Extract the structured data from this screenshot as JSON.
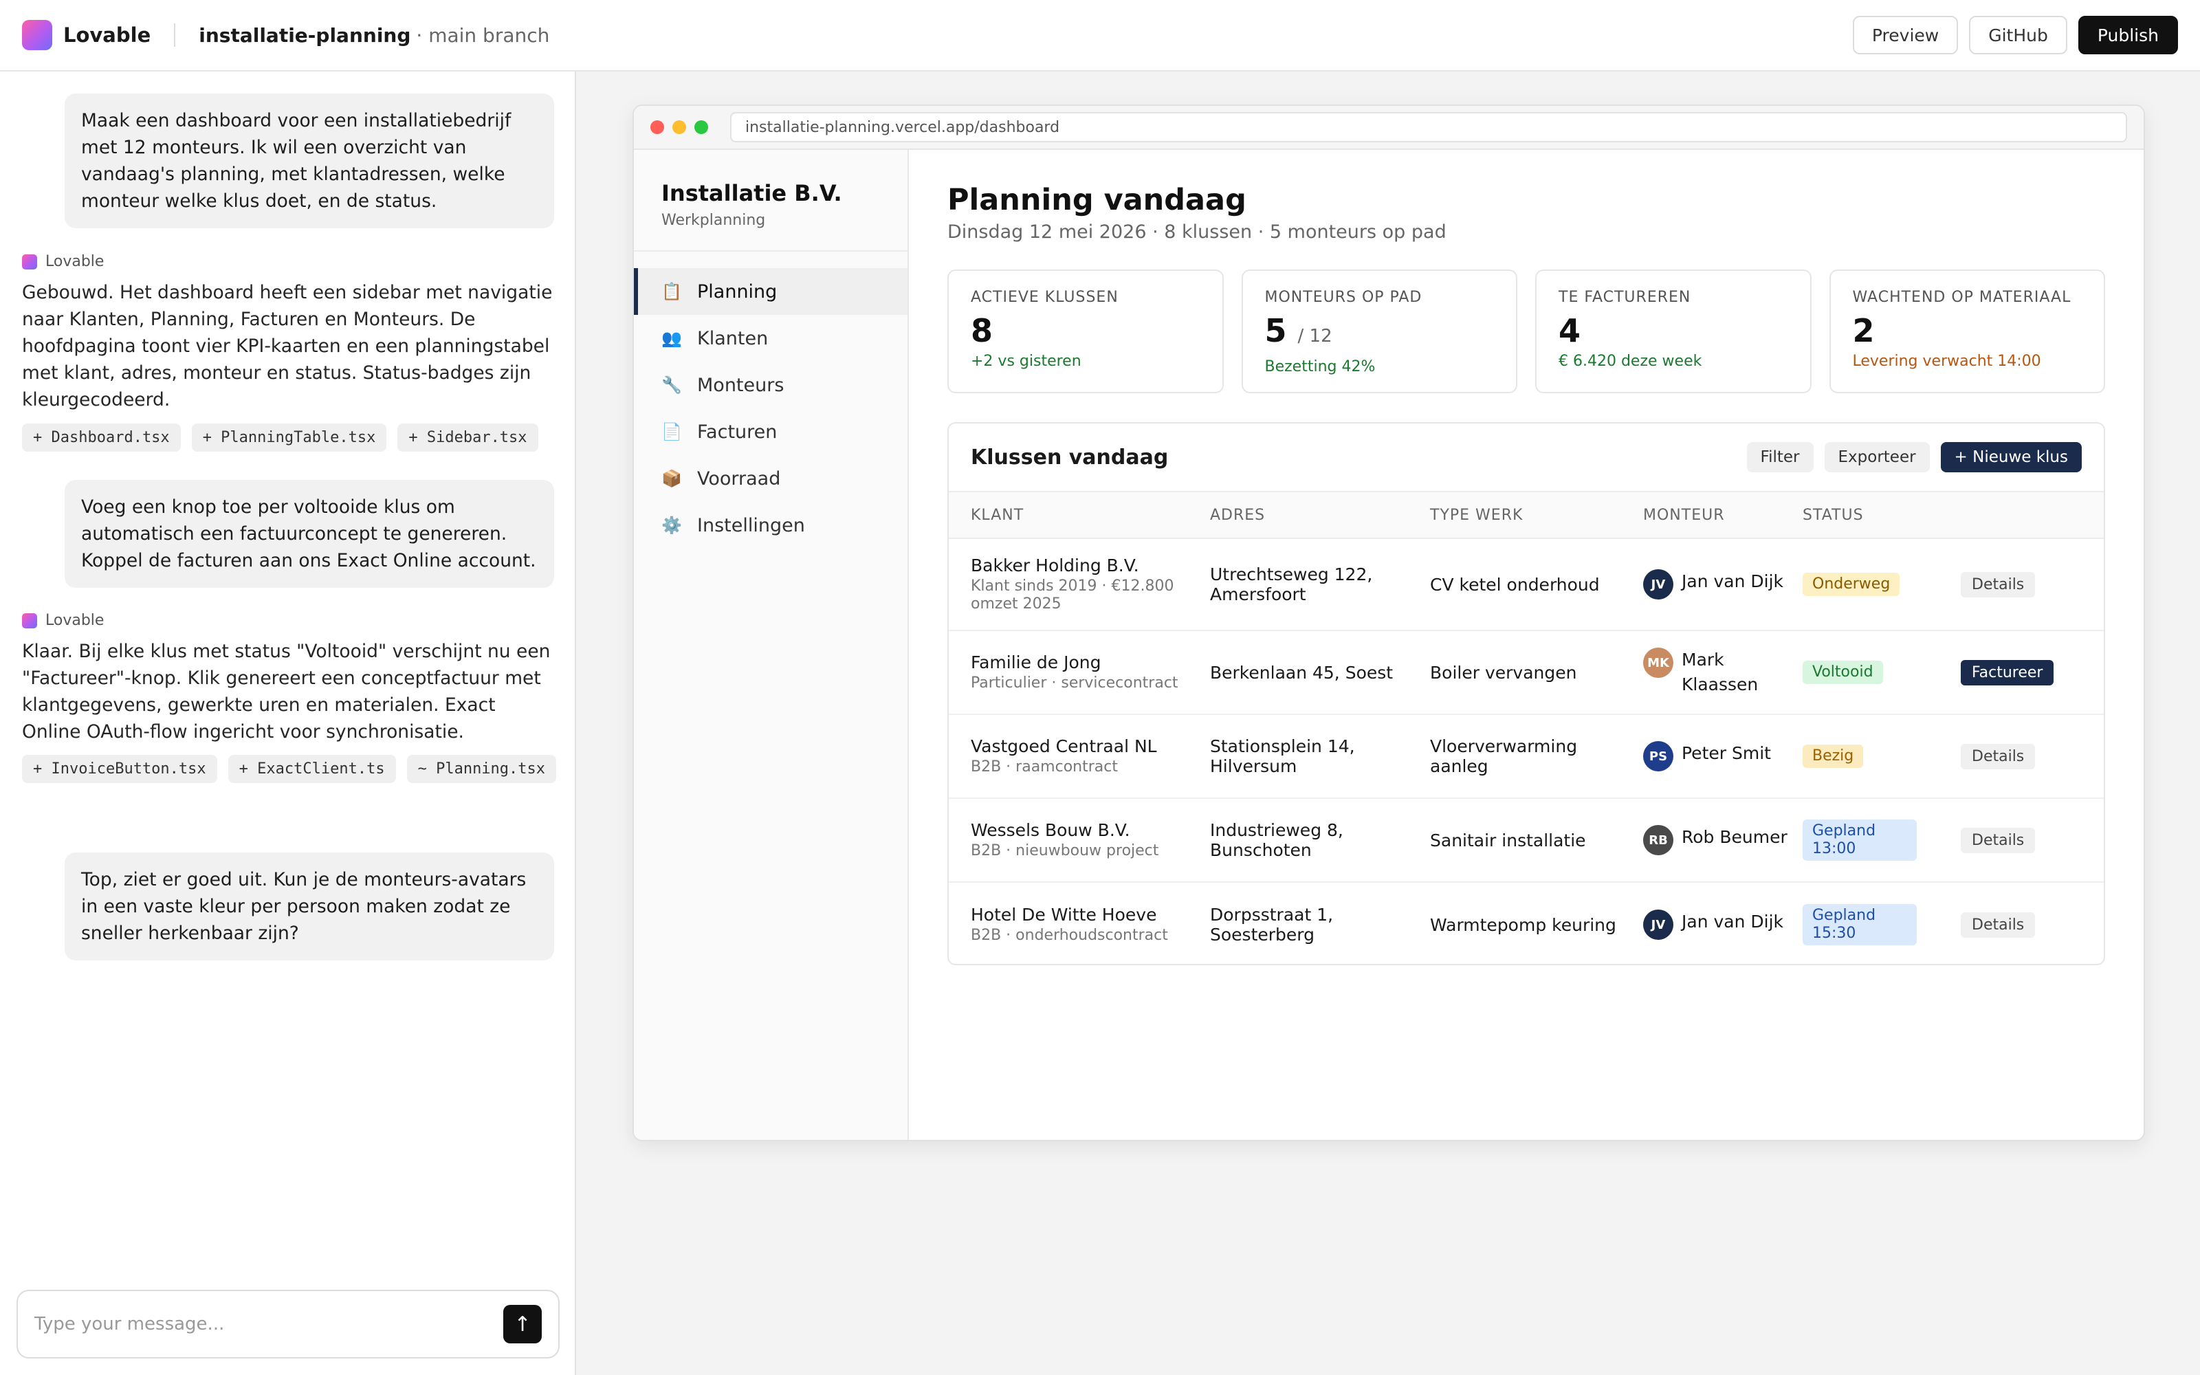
{
  "topbar": {
    "brand": "Lovable",
    "project": "installatie-planning",
    "branch": "· main branch",
    "preview": "Preview",
    "github": "GitHub",
    "publish": "Publish"
  },
  "chat": {
    "assistant_label": "Lovable",
    "messages": [
      "Maak een dashboard voor een installatiebedrijf met 12 monteurs. Ik wil een overzicht van vandaag's planning, met klantadressen, welke monteur welke klus doet, en de status.",
      "Gebouwd. Het dashboard heeft een sidebar met navigatie naar Klanten, Planning, Facturen en Monteurs. De hoofdpagina toont vier KPI-kaarten en een planningstabel met klant, adres, monteur en status. Status-badges zijn kleurgecodeerd.",
      "Voeg een knop toe per voltooide klus om automatisch een factuurconcept te genereren. Koppel de facturen aan ons Exact Online account.",
      "Klaar. Bij elke klus met status \"Voltooid\" verschijnt nu een \"Factureer\"-knop. Klik genereert een conceptfactuur met klantgegevens, gewerkte uren en materialen. Exact Online OAuth-flow ingericht voor synchronisatie.",
      "Top, ziet er goed uit. Kun je de monteurs-avatars in een vaste kleur per persoon maken zodat ze sneller herkenbaar zijn?"
    ],
    "chips1": [
      "+ Dashboard.tsx",
      "+ PlanningTable.tsx",
      "+ Sidebar.tsx"
    ],
    "chips2": [
      "+ InvoiceButton.tsx",
      "+ ExactClient.ts",
      "~ Planning.tsx"
    ],
    "input_placeholder": "Type your message...",
    "send_icon": "↑"
  },
  "browser": {
    "url": "installatie-planning.vercel.app/dashboard"
  },
  "app": {
    "company": "Installatie B.V.",
    "company_sub": "Werkplanning",
    "nav": [
      {
        "icon": "📋",
        "label": "Planning"
      },
      {
        "icon": "👥",
        "label": "Klanten"
      },
      {
        "icon": "🔧",
        "label": "Monteurs"
      },
      {
        "icon": "📄",
        "label": "Facturen"
      },
      {
        "icon": "📦",
        "label": "Voorraad"
      },
      {
        "icon": "⚙️",
        "label": "Instellingen"
      }
    ],
    "title": "Planning vandaag",
    "subtitle": "Dinsdag 12 mei 2026 · 8 klussen · 5 monteurs op pad",
    "kpis": [
      {
        "label": "Actieve klussen",
        "value": "8",
        "total": "",
        "trend": "+2 vs gisteren"
      },
      {
        "label": "Monteurs op pad",
        "value": "5",
        "total": "/ 12",
        "trend": "Bezetting 42%"
      },
      {
        "label": "Te factureren",
        "value": "4",
        "total": "",
        "trend": "€ 6.420 deze week"
      },
      {
        "label": "Wachtend op materiaal",
        "value": "2",
        "total": "",
        "trend": "Levering verwacht 14:00"
      }
    ],
    "table": {
      "title": "Klussen vandaag",
      "filter": "Filter",
      "export": "Exporteer",
      "new": "+ Nieuwe klus",
      "headers": [
        "Klant",
        "Adres",
        "Type werk",
        "Monteur",
        "Status"
      ],
      "rows": [
        {
          "klant": "Bakker Holding B.V.",
          "klant_sub": "Klant sinds 2019 · €12.800 omzet 2025",
          "adres": "Utrechtseweg 122, Amersfoort",
          "type": "CV ketel onderhoud",
          "initials": "JV",
          "monteur": "Jan van Dijk",
          "status": "Onderweg",
          "action": "Details"
        },
        {
          "klant": "Familie de Jong",
          "klant_sub": "Particulier · servicecontract",
          "adres": "Berkenlaan 45, Soest",
          "type": "Boiler vervangen",
          "initials": "MK",
          "monteur": "Mark Klaassen",
          "status": "Voltooid",
          "action": "Factureer"
        },
        {
          "klant": "Vastgoed Centraal NL",
          "klant_sub": "B2B · raamcontract",
          "adres": "Stationsplein 14, Hilversum",
          "type": "Vloerverwarming aanleg",
          "initials": "PS",
          "monteur": "Peter Smit",
          "status": "Bezig",
          "action": "Details"
        },
        {
          "klant": "Wessels Bouw B.V.",
          "klant_sub": "B2B · nieuwbouw project",
          "adres": "Industrieweg 8, Bunschoten",
          "type": "Sanitair installatie",
          "initials": "RB",
          "monteur": "Rob Beumer",
          "status": "Gepland 13:00",
          "action": "Details"
        },
        {
          "klant": "Hotel De Witte Hoeve",
          "klant_sub": "B2B · onderhoudscontract",
          "adres": "Dorpsstraat 1, Soesterberg",
          "type": "Warmtepomp keuring",
          "initials": "JV",
          "monteur": "Jan van Dijk",
          "status": "Gepland 15:30",
          "action": "Details"
        }
      ]
    }
  },
  "colors": {
    "avatar_jv": "#1b2b4b",
    "avatar_mk": "#c98b62",
    "avatar_ps": "#1e3e8c",
    "avatar_rb": "#4a4a4a",
    "accent": "#1b2b4b"
  }
}
